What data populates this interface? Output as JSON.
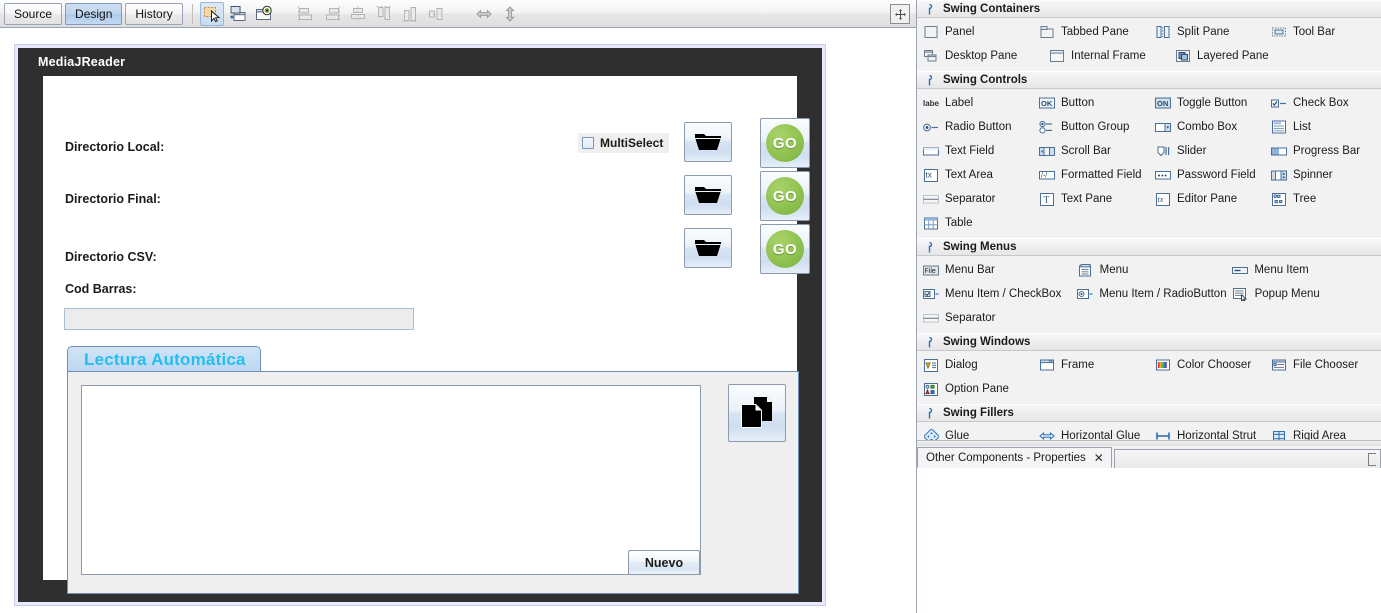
{
  "editor": {
    "toolbar": {
      "view_tabs": [
        {
          "label": "Source",
          "selected": false
        },
        {
          "label": "Design",
          "selected": true
        },
        {
          "label": "History",
          "selected": false
        }
      ],
      "tools": [
        {
          "name": "selection-mode-icon",
          "active": true
        },
        {
          "name": "connection-mode-icon",
          "active": false
        },
        {
          "name": "preview-design-icon",
          "active": false
        },
        {
          "name": "align-left-icon",
          "active": false
        },
        {
          "name": "align-right-icon",
          "active": false
        },
        {
          "name": "align-center-horizontal-icon",
          "active": false
        },
        {
          "name": "align-top-icon",
          "active": false
        },
        {
          "name": "align-bottom-icon",
          "active": false
        },
        {
          "name": "align-center-vertical-icon",
          "active": false
        },
        {
          "name": "resize-horizontal-icon",
          "active": false
        },
        {
          "name": "resize-vertical-icon",
          "active": false
        }
      ],
      "maximize_label": "maximize-window-icon"
    },
    "form": {
      "title": "MediaJReader",
      "fields": [
        {
          "label": "Directorio Local:",
          "browse": "folder-icon",
          "action": "GO"
        },
        {
          "label": "Directorio Final:",
          "browse": "folder-icon",
          "action": "GO"
        },
        {
          "label": "Directorio CSV:",
          "browse": "folder-icon",
          "action": "GO"
        }
      ],
      "multiselect": {
        "label": "MultiSelect",
        "checked": false
      },
      "barcode": {
        "label": "Cod Barras:",
        "value": "",
        "placeholder": ""
      },
      "tab": {
        "label": "Lectura Automática"
      },
      "log": {
        "value": "",
        "placeholder": ""
      },
      "copy_button": "copy-documents-icon",
      "new_button": "Nuevo"
    }
  },
  "palette": {
    "groups": [
      {
        "title": "Swing Containers",
        "columns": 4,
        "items": [
          {
            "label": "Panel",
            "icon": "panel-icon"
          },
          {
            "label": "Tabbed Pane",
            "icon": "tabbed-pane-icon"
          },
          {
            "label": "Split Pane",
            "icon": "split-pane-icon"
          },
          {
            "label": "Tool Bar",
            "icon": "tool-bar-icon"
          },
          {
            "label": "Desktop Pane",
            "icon": "desktop-pane-icon"
          },
          {
            "label": "Internal Frame",
            "icon": "internal-frame-icon"
          },
          {
            "label": "Layered Pane",
            "icon": "layered-pane-icon"
          }
        ]
      },
      {
        "title": "Swing Controls",
        "columns": 4,
        "items": [
          {
            "label": "Label",
            "icon": "label-icon"
          },
          {
            "label": "Button",
            "icon": "button-icon"
          },
          {
            "label": "Toggle Button",
            "icon": "toggle-button-icon"
          },
          {
            "label": "Check Box",
            "icon": "check-box-icon"
          },
          {
            "label": "Radio Button",
            "icon": "radio-button-icon"
          },
          {
            "label": "Button Group",
            "icon": "button-group-icon"
          },
          {
            "label": "Combo Box",
            "icon": "combo-box-icon"
          },
          {
            "label": "List",
            "icon": "list-icon"
          },
          {
            "label": "Text Field",
            "icon": "text-field-icon"
          },
          {
            "label": "Scroll Bar",
            "icon": "scroll-bar-icon"
          },
          {
            "label": "Slider",
            "icon": "slider-icon"
          },
          {
            "label": "Progress Bar",
            "icon": "progress-bar-icon"
          },
          {
            "label": "Text Area",
            "icon": "text-area-icon"
          },
          {
            "label": "Formatted Field",
            "icon": "formatted-field-icon"
          },
          {
            "label": "Password Field",
            "icon": "password-field-icon"
          },
          {
            "label": "Spinner",
            "icon": "spinner-icon"
          },
          {
            "label": "Separator",
            "icon": "separator-icon"
          },
          {
            "label": "Text Pane",
            "icon": "text-pane-icon"
          },
          {
            "label": "Editor Pane",
            "icon": "editor-pane-icon"
          },
          {
            "label": "Tree",
            "icon": "tree-icon"
          },
          {
            "label": "Table",
            "icon": "table-icon"
          }
        ]
      },
      {
        "title": "Swing Menus",
        "columns": 3,
        "items": [
          {
            "label": "Menu Bar",
            "icon": "menu-bar-icon"
          },
          {
            "label": "Menu",
            "icon": "menu-icon"
          },
          {
            "label": "Menu Item",
            "icon": "menu-item-icon"
          },
          {
            "label": "Menu Item / CheckBox",
            "icon": "menu-item-checkbox-icon"
          },
          {
            "label": "Menu Item / RadioButton",
            "icon": "menu-item-radiobutton-icon"
          },
          {
            "label": "Popup Menu",
            "icon": "popup-menu-icon"
          },
          {
            "label": "Separator",
            "icon": "separator-icon"
          }
        ]
      },
      {
        "title": "Swing Windows",
        "columns": 4,
        "items": [
          {
            "label": "Dialog",
            "icon": "dialog-icon"
          },
          {
            "label": "Frame",
            "icon": "frame-icon"
          },
          {
            "label": "Color Chooser",
            "icon": "color-chooser-icon"
          },
          {
            "label": "File Chooser",
            "icon": "file-chooser-icon"
          },
          {
            "label": "Option Pane",
            "icon": "option-pane-icon"
          }
        ]
      },
      {
        "title": "Swing Fillers",
        "columns": 4,
        "items": [
          {
            "label": "Glue",
            "icon": "glue-icon"
          },
          {
            "label": "Horizontal Glue",
            "icon": "horizontal-glue-icon"
          },
          {
            "label": "Horizontal Strut",
            "icon": "horizontal-strut-icon"
          },
          {
            "label": "Rigid Area",
            "icon": "rigid-area-icon"
          }
        ]
      }
    ]
  },
  "properties": {
    "tab_label": "Other Components - Properties",
    "close_label": "✕"
  },
  "colors": {
    "accent_blue": "#23bff0",
    "go_green": "#8dc04e",
    "frame_dark": "#2f2f2f",
    "selection": "#e8e9fb",
    "tab_selected": "#bdd5ef"
  }
}
